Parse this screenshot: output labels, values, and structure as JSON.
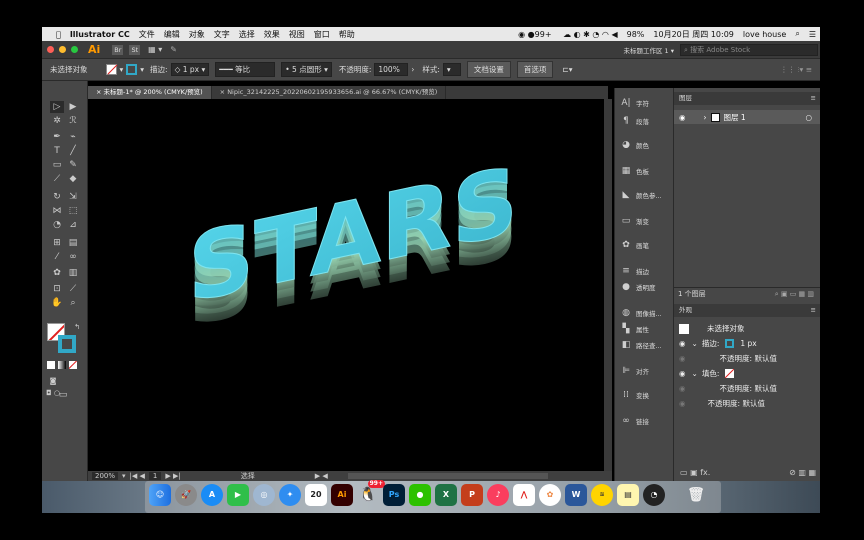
{
  "menubar": {
    "app_name": "Illustrator CC",
    "items": [
      "文件",
      "编辑",
      "对象",
      "文字",
      "选择",
      "效果",
      "视图",
      "窗口",
      "帮助"
    ],
    "status_count": "99+",
    "battery": "98%",
    "datetime": "10月20日 周四 10:09",
    "user": "love house"
  },
  "titlebar": {
    "logo": "Ai",
    "br": "Br",
    "st": "St",
    "workspace": "未标题工作区 1",
    "search_placeholder": "搜索 Adobe Stock"
  },
  "control": {
    "selection": "未选择对象",
    "stroke_label": "描边:",
    "stroke_value": "1 px",
    "stroke_style": "等比",
    "brush": "5 点圆形",
    "opacity_label": "不透明度:",
    "opacity_value": "100%",
    "style_label": "样式:",
    "doc_settings": "文档设置",
    "preferences": "首选项"
  },
  "tabs": [
    {
      "label": "未标题-1* @ 200% (CMYK/预览)"
    },
    {
      "label": "Nipic_32142225_20220602195933656.ai @ 66.67% (CMYK/预览)"
    }
  ],
  "artwork": {
    "text": "STARS"
  },
  "status": {
    "zoom": "200%",
    "page": "1",
    "mode": "选择"
  },
  "midpanel": [
    "字符",
    "段落",
    "颜色",
    "色板",
    "颜色参...",
    "渐变",
    "画笔",
    "描边",
    "透明度",
    "图像描...",
    "属性",
    "路径查...",
    "对齐",
    "变换",
    "链接"
  ],
  "layers": {
    "title": "图层",
    "layer_name": "图层 1",
    "count": "1 个图层"
  },
  "appearance": {
    "title": "外观",
    "no_selection": "未选择对象",
    "stroke_label": "描边:",
    "stroke_value": "1 px",
    "opacity1": "不透明度: 默认值",
    "fill_label": "填色:",
    "opacity2": "不透明度: 默认值",
    "opacity3": "不透明度: 默认值"
  },
  "dock": {
    "calendar_day": "20",
    "ai": "Ai",
    "ps": "Ps",
    "badge": "99+"
  },
  "colors": {
    "accent": "#2e7bd6",
    "artwork_top": "#4fd3e8",
    "artwork_side": "#9ad6b0"
  }
}
